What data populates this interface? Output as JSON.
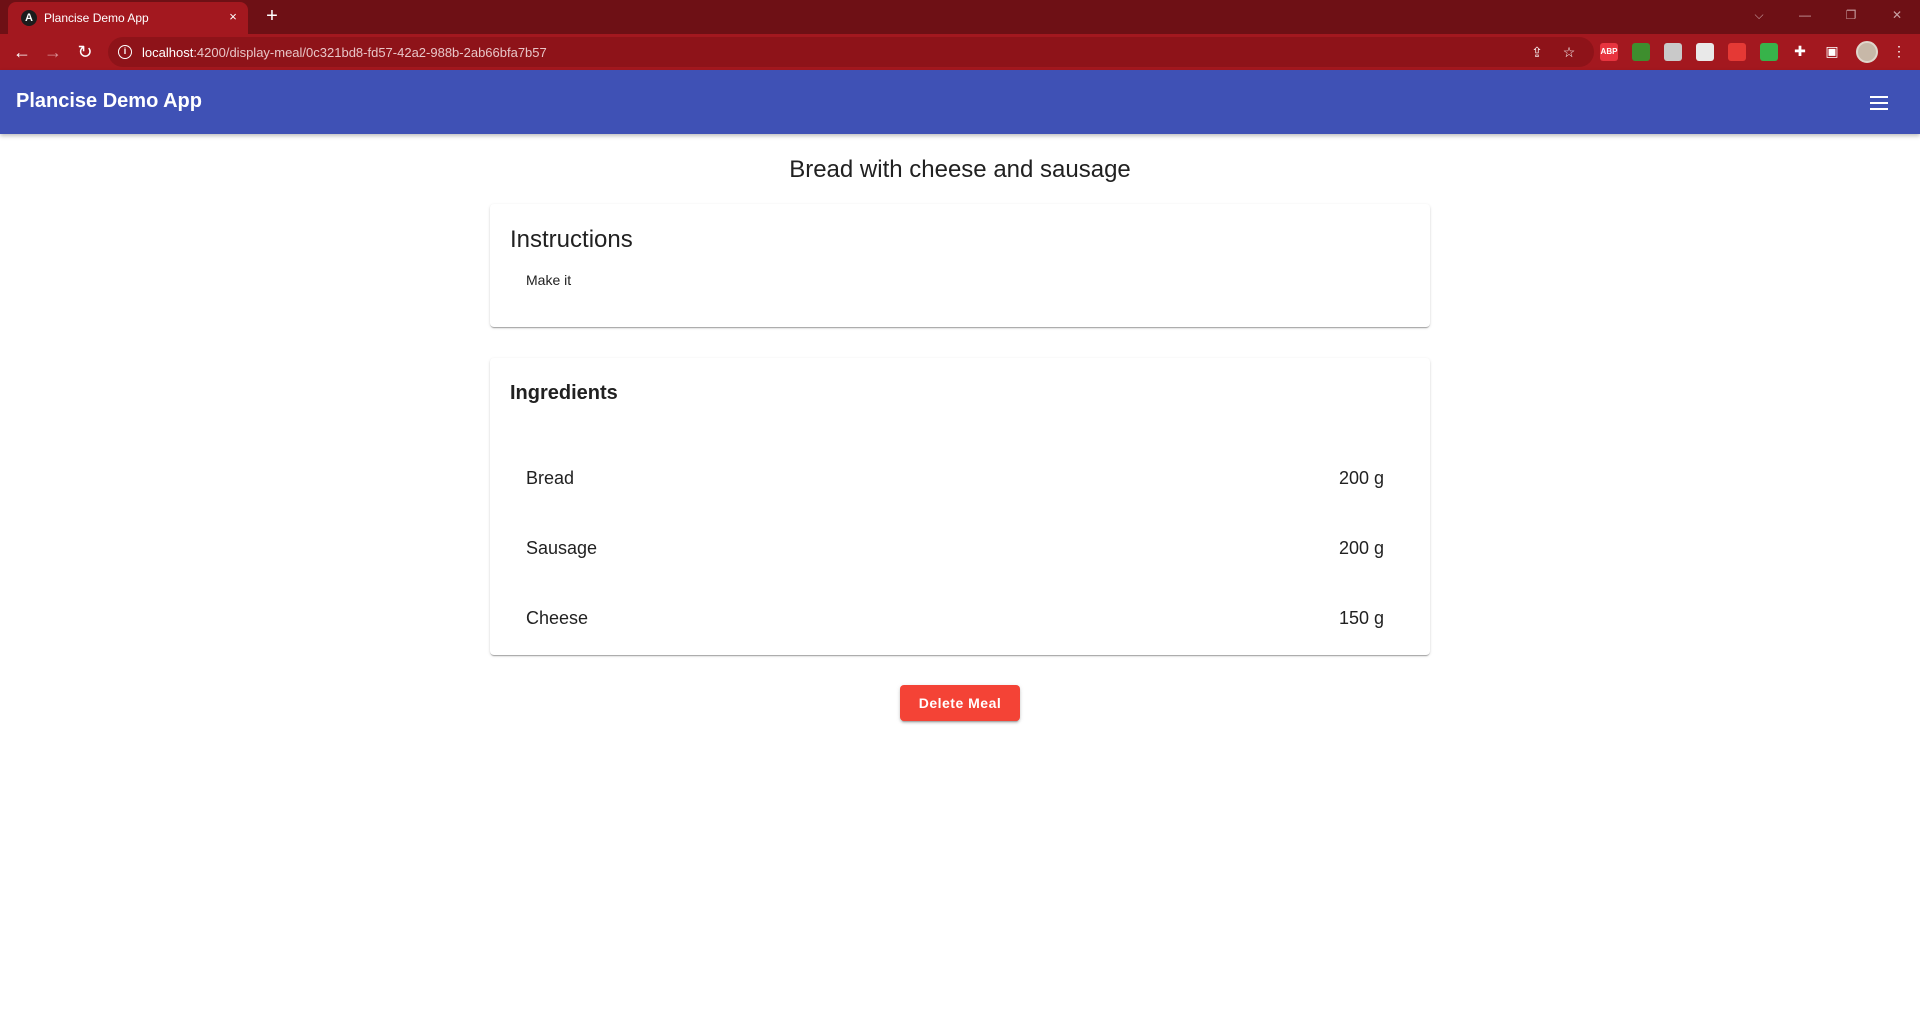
{
  "browser": {
    "tab_title": "Plancise Demo App",
    "tab_favicon_letter": "A",
    "tab_close": "×",
    "new_tab": "+",
    "url_host": "localhost",
    "url_rest": ":4200/display-meal/0c321bd8-fd57-42a2-988b-2ab66bfa7b57",
    "extensions": [
      {
        "name": "adblock-extension-icon",
        "label": "ABP",
        "color": "#e8343f"
      },
      {
        "name": "extension-icon-2",
        "label": "",
        "color": "#3e8e2e"
      },
      {
        "name": "extension-icon-3",
        "label": "",
        "color": "#c9c9c9"
      },
      {
        "name": "extension-icon-4",
        "label": "",
        "color": "#e9e9e9"
      },
      {
        "name": "extension-icon-5",
        "label": "",
        "color": "#e53935"
      },
      {
        "name": "extension-icon-6",
        "label": "",
        "color": "#37b34a"
      }
    ]
  },
  "app": {
    "title": "Plancise Demo App"
  },
  "meal": {
    "name": "Bread with cheese and sausage",
    "instructions_heading": "Instructions",
    "instructions": "Make it",
    "ingredients_heading": "Ingredients",
    "ingredients": [
      {
        "name": "Bread",
        "amount": "200 g"
      },
      {
        "name": "Sausage",
        "amount": "200 g"
      },
      {
        "name": "Cheese",
        "amount": "150 g"
      }
    ],
    "delete_label": "Delete Meal"
  },
  "colors": {
    "tabstrip": "#6e1015",
    "toolbar": "#a3181f",
    "primary": "#3f51b5",
    "warn": "#f44336"
  }
}
